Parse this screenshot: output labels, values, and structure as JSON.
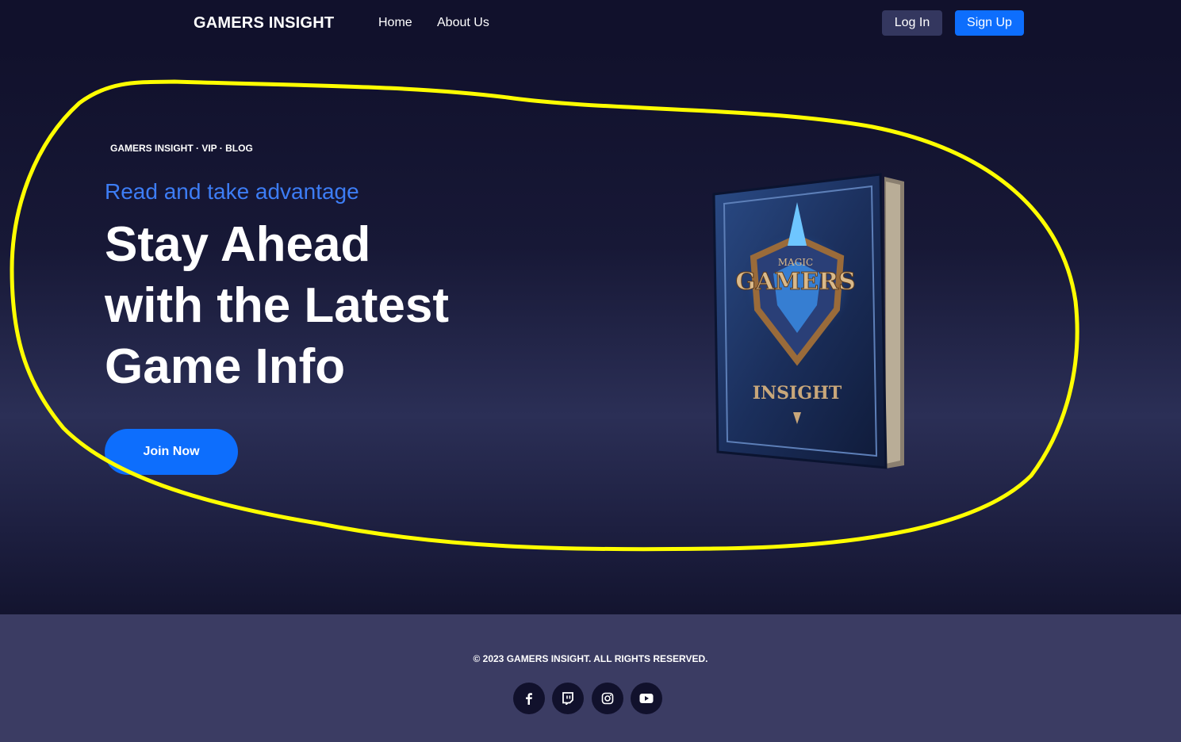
{
  "navbar": {
    "brand": "GAMERS INSIGHT",
    "links": [
      {
        "label": "Home"
      },
      {
        "label": "About Us"
      }
    ],
    "login_label": "Log In",
    "signup_label": "Sign Up"
  },
  "hero": {
    "eyebrow": "GAMERS INSIGHT · VIP · BLOG",
    "tagline": "Read and take advantage",
    "headline_lines": [
      "Stay Ahead",
      "with the Latest",
      "Game Info"
    ],
    "cta_label": "Join Now",
    "book_cover": {
      "top_text": "MAGIC",
      "title": "GAMERS",
      "subtitle": "INSIGHT"
    }
  },
  "footer": {
    "copyright": "© 2023 GAMERS INSIGHT. ALL RIGHTS RESERVED.",
    "social_icons": [
      "facebook-icon",
      "twitch-icon",
      "instagram-icon",
      "youtube-icon"
    ]
  },
  "colors": {
    "background": "#11112c",
    "accent": "#0d6efd",
    "tagline": "#3d7df5",
    "footer": "#3b3c63",
    "annotation": "#ffff00"
  }
}
